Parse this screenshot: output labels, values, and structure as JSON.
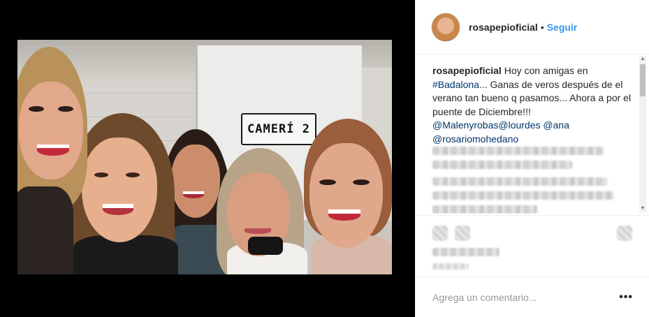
{
  "post": {
    "photo_sign": "CAMERÍ 2"
  },
  "header": {
    "username": "rosapepioficial",
    "separator": "•",
    "follow_label": "Seguir"
  },
  "caption": {
    "author": "rosapepioficial",
    "text_part1": " Hoy con amigas en ",
    "hashtag": "#Badalona",
    "text_part2": "... Ganas de veros después de el verano tan bueno q pasamos... Ahora a por el puente de Diciembre!!! ",
    "mention1": "@Malenyrobas",
    "mention2": "@lourdes",
    "mention3": "@ana",
    "mention4": "@rosariomohedano"
  },
  "comment": {
    "placeholder": "Agrega un comentario...",
    "more_label": "•••"
  },
  "colors": {
    "follow": "#3897f0",
    "link": "#003569",
    "text": "#262626",
    "background": "#000000"
  }
}
